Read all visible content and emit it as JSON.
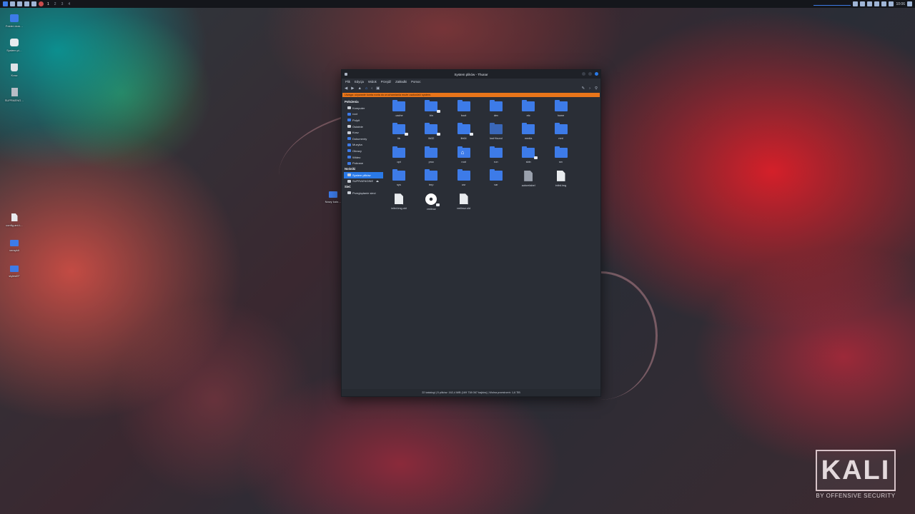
{
  "top_panel": {
    "workspaces": [
      "1",
      "2",
      "3",
      "4"
    ],
    "clock": "10:06"
  },
  "desktop": {
    "icons": [
      {
        "name": "home",
        "label": "Folder dom…",
        "icon": "home-folder-icon"
      },
      {
        "name": "filesystem",
        "label": "System pl…",
        "icon": "filesystem-icon"
      },
      {
        "name": "trash",
        "label": "Kosz",
        "icon": "trash-icon"
      },
      {
        "name": "usb",
        "label": "SUPRAENG…",
        "icon": "usb-drive-icon"
      },
      {
        "name": "config",
        "label": "config-ani.t…",
        "icon": "file-icon"
      },
      {
        "name": "veraykit",
        "label": "veraykit",
        "icon": "folder-icon"
      },
      {
        "name": "styles",
        "label": "stylesEF",
        "icon": "folder-icon"
      }
    ],
    "stray_label": "Nowy kata…"
  },
  "window": {
    "title": "System plików - Thunar",
    "menu": [
      "Plik",
      "Edycja",
      "Widok",
      "Przejdź",
      "Zakładki",
      "Pomoc"
    ],
    "warning": "Uwaga: używanie konta roota do uruchamiania może uszkodzić system.",
    "sidebar": {
      "sections": [
        {
          "header": "Położenia",
          "items": [
            {
              "label": "Komputer",
              "icon": "computer-icon"
            },
            {
              "label": "root",
              "icon": "folder-icon"
            },
            {
              "label": "Pulpit",
              "icon": "desktop-icon"
            },
            {
              "label": "Ostatnie",
              "icon": "recent-icon"
            },
            {
              "label": "Kosz",
              "icon": "trash-icon"
            },
            {
              "label": "Dokumenty",
              "icon": "folder-icon"
            },
            {
              "label": "Muzyka",
              "icon": "folder-icon"
            },
            {
              "label": "Obrazy",
              "icon": "folder-icon"
            },
            {
              "label": "Wideo",
              "icon": "folder-icon"
            },
            {
              "label": "Pobrane",
              "icon": "folder-icon"
            }
          ]
        },
        {
          "header": "Nośniki",
          "items": [
            {
              "label": "System plików",
              "icon": "filesystem-icon",
              "selected": true
            },
            {
              "label": "SUPRAENGINE",
              "icon": "usb-drive-icon",
              "eject": "⏏"
            }
          ]
        },
        {
          "header": "Sieć",
          "items": [
            {
              "label": "Przeglądanie sieci",
              "icon": "network-icon"
            }
          ]
        }
      ]
    },
    "files": [
      {
        "label": ".cache",
        "type": "folder"
      },
      {
        "label": "bin",
        "type": "folder",
        "link": true
      },
      {
        "label": "boot",
        "type": "folder"
      },
      {
        "label": "dev",
        "type": "folder"
      },
      {
        "label": "etc",
        "type": "folder"
      },
      {
        "label": "home",
        "type": "folder"
      },
      {
        "label": "lib",
        "type": "folder",
        "link": true
      },
      {
        "label": "lib32",
        "type": "folder",
        "link": true
      },
      {
        "label": "lib64",
        "type": "folder",
        "link": true
      },
      {
        "label": "lost+found",
        "type": "folder",
        "dim": true
      },
      {
        "label": "media",
        "type": "folder"
      },
      {
        "label": "mnt",
        "type": "folder"
      },
      {
        "label": "opt",
        "type": "folder"
      },
      {
        "label": "proc",
        "type": "folder"
      },
      {
        "label": "root",
        "type": "home"
      },
      {
        "label": "run",
        "type": "folder"
      },
      {
        "label": "sbin",
        "type": "folder",
        "link": true
      },
      {
        "label": "srv",
        "type": "folder"
      },
      {
        "label": "sys",
        "type": "folder"
      },
      {
        "label": "tmp",
        "type": "folder"
      },
      {
        "label": "usr",
        "type": "folder"
      },
      {
        "label": "var",
        "type": "folder"
      },
      {
        "label": "autorelabel",
        "type": "doc-grey"
      },
      {
        "label": "initrd.img",
        "type": "doc",
        "link": true
      },
      {
        "label": "initrd.img.old",
        "type": "doc",
        "link": true
      },
      {
        "label": "vmlinuz",
        "type": "gear",
        "link": true
      },
      {
        "label": "vmlinuz.old",
        "type": "doc",
        "link": true
      }
    ],
    "status": "22 katalogi  |  5 plików: 162,4 MiB (169 738 067 bajtów)  |  Wolna przestrzeń: 1,6 TiB"
  },
  "watermark": {
    "brand": "KALI",
    "tagline": "BY OFFENSIVE SECURITY"
  },
  "colors": {
    "accent": "#2a7ae8",
    "folder": "#3d7be8",
    "warning": "#e8751a",
    "window_bg": "#2a2e36"
  }
}
